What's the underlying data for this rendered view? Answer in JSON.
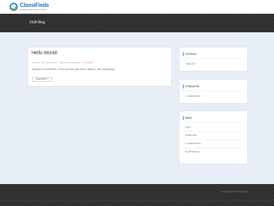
{
  "header": {
    "logo_name": "ClassiFieds",
    "logo_tagline": "Classified WordPress Theme"
  },
  "hero": {
    "title": "OUR Blog"
  },
  "post": {
    "title": "Hello World!",
    "meta": {
      "by_label": "By",
      "author": "admin",
      "date_label": "Date",
      "date": "May 25 2020",
      "categories_label": "Categories",
      "category": "Uncategorized",
      "comments": "1 Comment"
    },
    "excerpt": "Welcome to WordPress. This is your first post. Edit or delete it, then start writing!",
    "read_more_label": "Read More »"
  },
  "sidebar": {
    "archives": {
      "title": "Archives",
      "items": [
        "May 2020"
      ]
    },
    "categories": {
      "title": "Categories",
      "items": [
        "Uncategorized"
      ]
    },
    "meta": {
      "title": "Meta",
      "items": [
        "Log in",
        "Entries feed",
        "Comments feed",
        "WordPress.org"
      ]
    }
  },
  "footer": {
    "copyright": "Copyright All Rights Reserved"
  },
  "colors": {
    "page_bg": "#e8eef6",
    "dark_band": "#2d2d2d",
    "brand_blue": "#1c6fb8",
    "accent_red": "#e05555"
  }
}
